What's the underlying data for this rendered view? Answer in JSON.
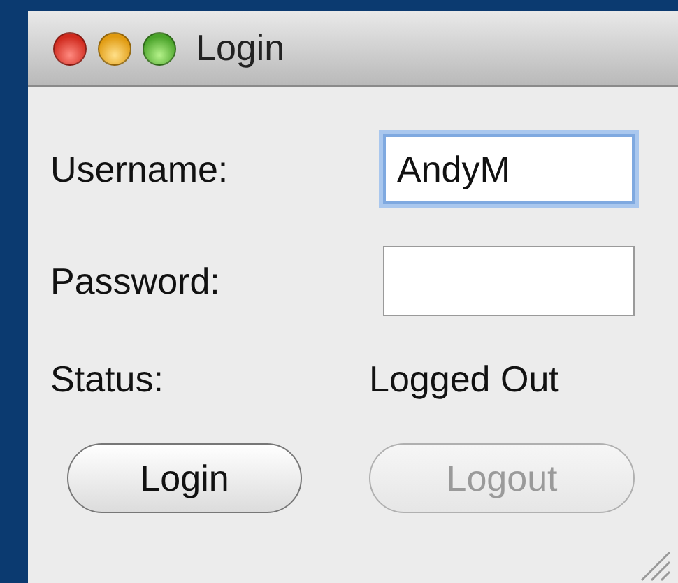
{
  "window": {
    "title": "Login"
  },
  "fields": [
    {
      "kind": "text",
      "label": "Username:",
      "value": "AndyM",
      "focused": true
    },
    {
      "kind": "password",
      "label": "Password:",
      "focused": false
    }
  ],
  "status": {
    "label": "Status:",
    "value": "Logged Out"
  },
  "buttons": [
    {
      "label": "Login",
      "disabled": false
    },
    {
      "label": "Logout",
      "disabled": true
    }
  ]
}
